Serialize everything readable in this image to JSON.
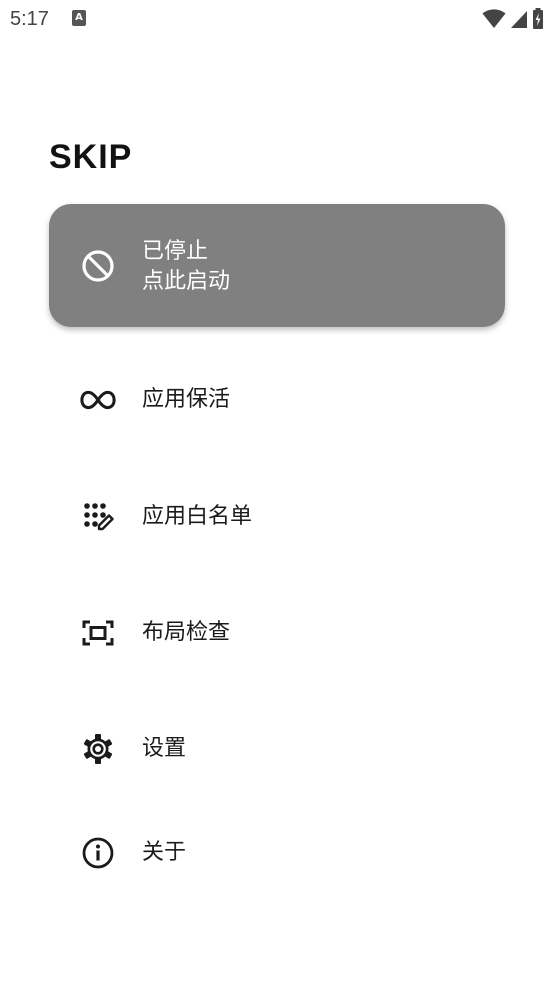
{
  "status_bar": {
    "time": "5:17",
    "notification_icon": "A",
    "icons": [
      "wifi-icon",
      "cell-signal-icon",
      "battery-charging-icon"
    ]
  },
  "app": {
    "title": "SKIP"
  },
  "status_card": {
    "icon": "block-icon",
    "line1": "已停止",
    "line2": "点此启动",
    "background": "#808080"
  },
  "menu": {
    "items": [
      {
        "icon": "infinity-icon",
        "label": "应用保活"
      },
      {
        "icon": "dots-edit-icon",
        "label": "应用白名单"
      },
      {
        "icon": "focus-frame-icon",
        "label": "布局检查"
      },
      {
        "icon": "gear-icon",
        "label": "设置"
      },
      {
        "icon": "info-icon",
        "label": "关于"
      }
    ]
  },
  "colors": {
    "text": "#1b1b1b",
    "card": "#808080",
    "background": "#ffffff"
  }
}
